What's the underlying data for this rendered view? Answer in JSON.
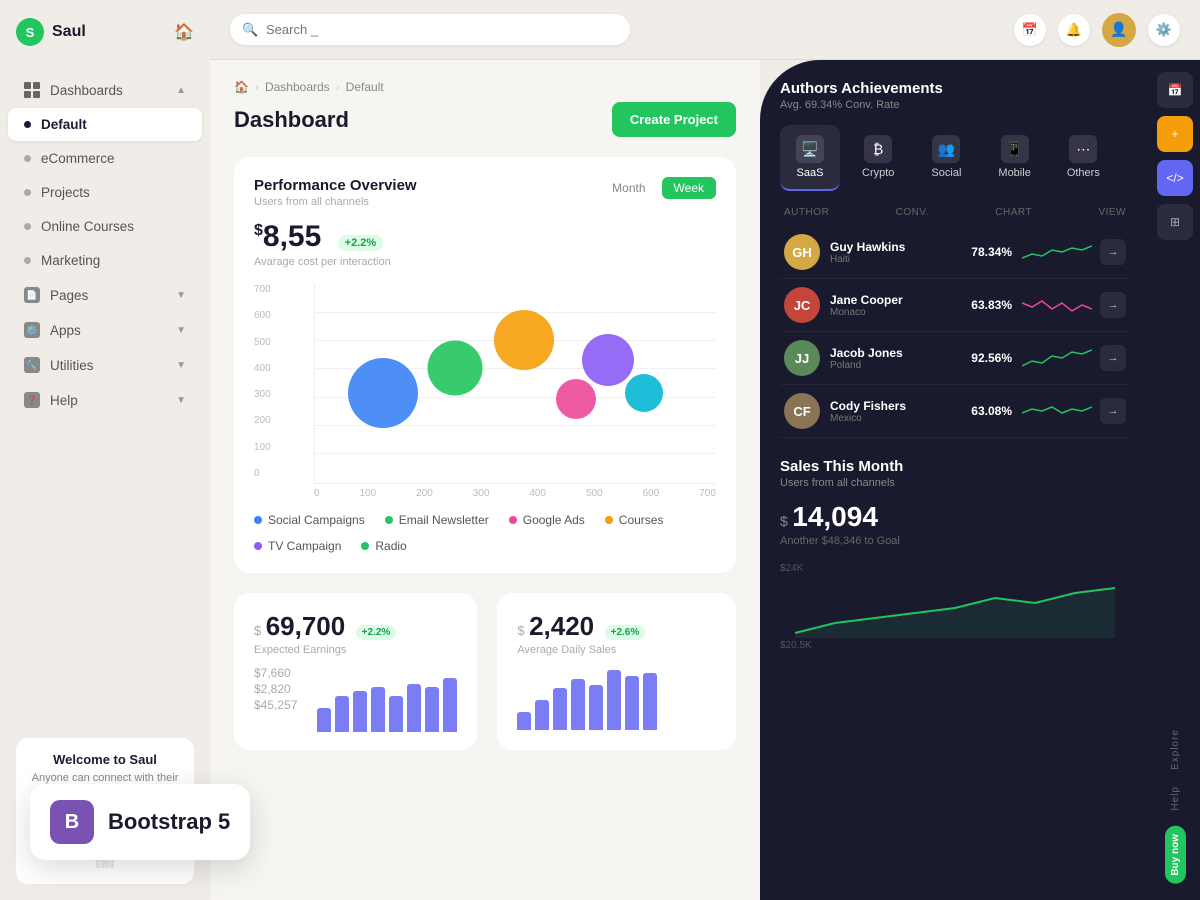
{
  "app": {
    "name": "Saul",
    "logo_letter": "S"
  },
  "sidebar": {
    "nav_items": [
      {
        "id": "dashboards",
        "label": "Dashboards",
        "type": "grid",
        "has_arrow": true,
        "active": false
      },
      {
        "id": "default",
        "label": "Default",
        "type": "dot",
        "active": true
      },
      {
        "id": "ecommerce",
        "label": "eCommerce",
        "type": "dot",
        "active": false
      },
      {
        "id": "projects",
        "label": "Projects",
        "type": "dot",
        "active": false
      },
      {
        "id": "online-courses",
        "label": "Online Courses",
        "type": "dot",
        "active": false
      },
      {
        "id": "marketing",
        "label": "Marketing",
        "type": "dot",
        "active": false
      },
      {
        "id": "pages",
        "label": "Pages",
        "type": "icon",
        "has_arrow": true,
        "active": false
      },
      {
        "id": "apps",
        "label": "Apps",
        "type": "icon2",
        "has_arrow": true,
        "active": false
      },
      {
        "id": "utilities",
        "label": "Utilities",
        "type": "icon3",
        "has_arrow": true,
        "active": false
      },
      {
        "id": "help",
        "label": "Help",
        "type": "icon4",
        "has_arrow": true,
        "active": false
      }
    ],
    "welcome": {
      "title": "Welcome to Saul",
      "subtitle": "Anyone can connect with their audience blogging"
    }
  },
  "topbar": {
    "search_placeholder": "Search _"
  },
  "breadcrumb": {
    "home": "🏠",
    "dashboards": "Dashboards",
    "current": "Default"
  },
  "page": {
    "title": "Dashboard",
    "create_button": "Create Project"
  },
  "performance": {
    "title": "Performance Overview",
    "subtitle": "Users from all channels",
    "period_month": "Month",
    "period_week": "Week",
    "value": "8,55",
    "currency": "$",
    "badge": "+2.2%",
    "label": "Avarage cost per interaction",
    "y_axis": [
      "700",
      "600",
      "500",
      "400",
      "300",
      "200",
      "100",
      "0"
    ],
    "x_axis": [
      "0",
      "100",
      "200",
      "300",
      "400",
      "500",
      "600",
      "700"
    ],
    "bubbles": [
      {
        "x": 17,
        "y": 55,
        "size": 70,
        "color": "#3b82f6"
      },
      {
        "x": 35,
        "y": 42,
        "size": 55,
        "color": "#22c55e"
      },
      {
        "x": 52,
        "y": 28,
        "size": 60,
        "color": "#f59e0b"
      },
      {
        "x": 65,
        "y": 55,
        "size": 40,
        "color": "#ec4899"
      },
      {
        "x": 73,
        "y": 38,
        "size": 50,
        "color": "#8b5cf6"
      },
      {
        "x": 82,
        "y": 55,
        "size": 35,
        "color": "#06b6d4"
      }
    ],
    "legend": [
      {
        "label": "Social Campaigns",
        "color": "#3b82f6"
      },
      {
        "label": "Email Newsletter",
        "color": "#22c55e"
      },
      {
        "label": "Google Ads",
        "color": "#ec4899"
      },
      {
        "label": "Courses",
        "color": "#f59e0b"
      },
      {
        "label": "TV Campaign",
        "color": "#8b5cf6"
      },
      {
        "label": "Radio",
        "color": "#22c55e"
      }
    ]
  },
  "stats": [
    {
      "currency": "$",
      "value": "69,700",
      "badge": "+2.2%",
      "label": "Expected Earnings",
      "amounts": [
        "$7,660",
        "$2,820",
        "$45,257"
      ],
      "bars": [
        30,
        45,
        50,
        55,
        45,
        60,
        55,
        65
      ]
    },
    {
      "currency": "$",
      "value": "2,420",
      "badge": "+2.6%",
      "label": "Average Daily Sales",
      "bars": [
        20,
        35,
        50,
        60,
        55,
        70,
        65,
        75
      ]
    }
  ],
  "authors": {
    "title": "Authors Achievements",
    "subtitle": "Avg. 69.34% Conv. Rate",
    "categories": [
      {
        "id": "saas",
        "label": "SaaS",
        "icon": "🖥️",
        "active": true
      },
      {
        "id": "crypto",
        "label": "Crypto",
        "icon": "₿",
        "active": false
      },
      {
        "id": "social",
        "label": "Social",
        "icon": "👥",
        "active": false
      },
      {
        "id": "mobile",
        "label": "Mobile",
        "icon": "📱",
        "active": false
      },
      {
        "id": "others",
        "label": "Others",
        "icon": "⋯",
        "active": false
      }
    ],
    "table_headers": [
      "AUTHOR",
      "CONV.",
      "CHART",
      "VIEW"
    ],
    "authors": [
      {
        "name": "Guy Hawkins",
        "location": "Haiti",
        "conv": "78.34%",
        "color": "#d4a843",
        "initials": "GH",
        "sparkline_color": "#22c55e"
      },
      {
        "name": "Jane Cooper",
        "location": "Monaco",
        "conv": "63.83%",
        "color": "#c4453a",
        "initials": "JC",
        "sparkline_color": "#ec4899"
      },
      {
        "name": "Jacob Jones",
        "location": "Poland",
        "conv": "92.56%",
        "color": "#5a8a5a",
        "initials": "JJ",
        "sparkline_color": "#22c55e"
      },
      {
        "name": "Cody Fishers",
        "location": "Mexico",
        "conv": "63.08%",
        "color": "#8b7355",
        "initials": "CF",
        "sparkline_color": "#22c55e"
      }
    ]
  },
  "sales": {
    "title": "Sales This Month",
    "subtitle": "Users from all channels",
    "currency": "$",
    "value": "14,094",
    "goal_text": "Another $48,346 to Goal",
    "y_labels": [
      "$24K",
      "$20.5K"
    ]
  },
  "right_edge": {
    "explore_label": "Explore",
    "help_label": "Help",
    "buy_label": "Buy now"
  }
}
